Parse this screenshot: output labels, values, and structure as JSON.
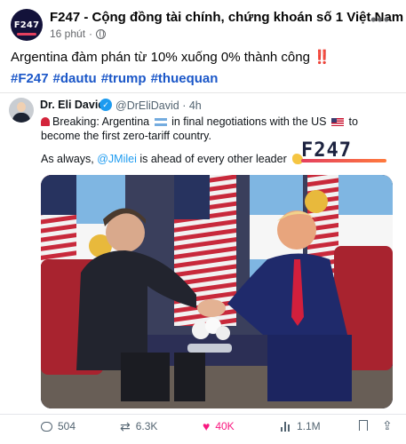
{
  "post": {
    "page_name": "F247 - Cộng đồng tài chính, chứng khoán số 1 Việt Nam",
    "time_ago": "16 phút",
    "avatar_logo": "F247",
    "text": "Argentina đàm phán từ 10% xuống 0% thành công",
    "alert_glyph": "‼️",
    "hashtags": [
      "#F247",
      "#dautu",
      "#trump",
      "#thuequan"
    ]
  },
  "embed": {
    "author_name": "Dr. Eli David",
    "author_handle": "@DrEliDavid · 4h",
    "line1_a": "Breaking: Argentina",
    "line1_b": "in final negotiations with the US",
    "line1_c": "to become the first zero-tariff country.",
    "line2_a": "As always,",
    "mention": "@JMilei",
    "line2_b": "is ahead of every other leader",
    "brand_mark": "F247"
  },
  "actions": {
    "replies": "504",
    "reposts": "6.3K",
    "likes": "40K",
    "views": "1.1M"
  },
  "colors": {
    "link": "#1b57c8",
    "like": "#f91880",
    "tweet_link": "#1d9bf0"
  },
  "icons": [
    "globe-icon",
    "more-icon",
    "verified-icon",
    "reply-icon",
    "retweet-icon",
    "heart-icon",
    "views-icon",
    "bookmark-icon",
    "share-icon"
  ]
}
